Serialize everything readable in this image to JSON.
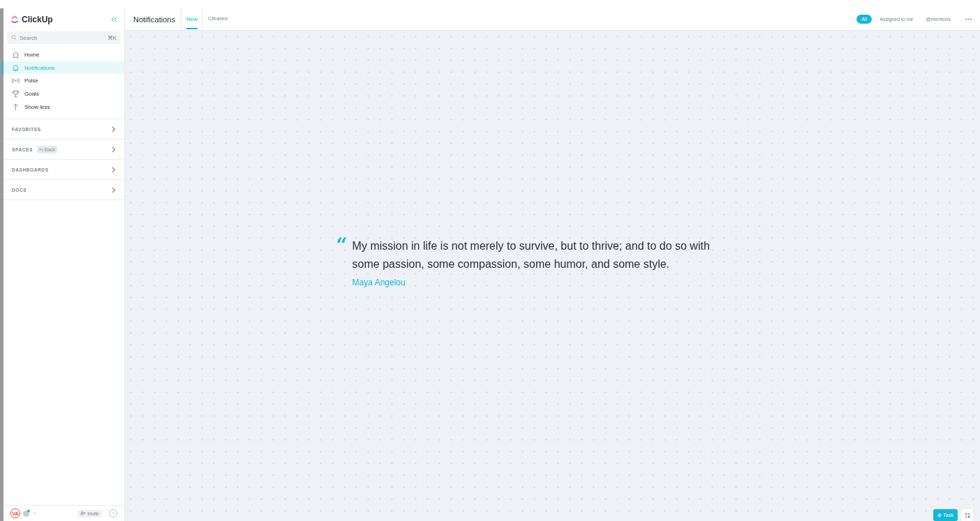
{
  "logo": {
    "text": "ClickUp"
  },
  "sidebar": {
    "search": {
      "placeholder": "Search",
      "shortcut": "⌘K"
    },
    "nav": [
      {
        "label": "Home",
        "kind": "home",
        "selected": false
      },
      {
        "label": "Notifications",
        "kind": "notifications",
        "selected": true
      },
      {
        "label": "Pulse",
        "kind": "pulse",
        "selected": false
      },
      {
        "label": "Goals",
        "kind": "goals",
        "selected": false
      },
      {
        "label": "Show less",
        "kind": "toggle",
        "selected": false
      }
    ],
    "sections": [
      {
        "label": "FAVORITES"
      },
      {
        "label": "SPACES",
        "badge": "Back"
      },
      {
        "label": "DASHBOARDS"
      },
      {
        "label": "DOCS"
      }
    ],
    "footer": {
      "avatar": "VA",
      "invite": "Invite",
      "help": "?"
    }
  },
  "header": {
    "title": "Notifications",
    "tabs": [
      {
        "label": "New",
        "selected": true
      },
      {
        "label": "Cleared",
        "selected": false
      }
    ],
    "filters": [
      {
        "label": "All",
        "selected": true
      },
      {
        "label": "Assigned to me",
        "selected": false
      },
      {
        "label": "@mentions",
        "selected": false
      }
    ]
  },
  "quote": {
    "mark": "“",
    "text": "My mission in life is not merely to survive, but to thrive; and to do so with some passion, some compassion, some humor, and some style.",
    "author": "Maya Angelou"
  },
  "fab": {
    "label": "Task"
  }
}
